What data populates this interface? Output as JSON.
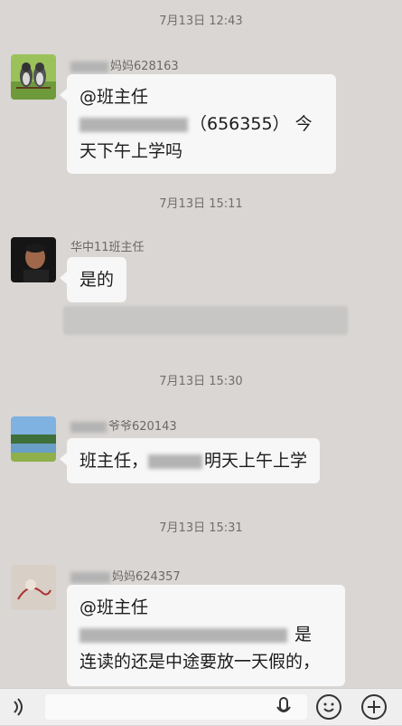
{
  "timestamps": [
    "7月13日 12:43",
    "7月13日 15:11",
    "7月13日 15:30",
    "7月13日 15:31"
  ],
  "messages": [
    {
      "sender_suffix": "妈妈628163",
      "lines": [
        "@班主任",
        "（656355） 今",
        "天下午上学吗"
      ]
    },
    {
      "sender": "华中11班主任",
      "text": "是的"
    },
    {
      "sender_suffix": "爷爷620143",
      "prefix": "班主任，",
      "suffix": "明天上午上学"
    },
    {
      "sender_suffix": "妈妈624357",
      "line1": "@班主任",
      "line2_end": "是",
      "line3": "连读的还是中途要放一天假的，"
    }
  ],
  "colors": {
    "background": "#d9d6d3",
    "bubble": "#f7f7f7"
  },
  "icons": [
    "voice-icon",
    "mic-icon",
    "emoji-icon",
    "plus-icon"
  ]
}
